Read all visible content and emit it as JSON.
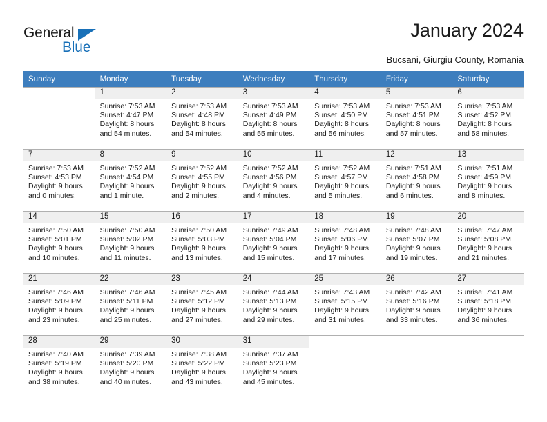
{
  "brand": {
    "name_part1": "General",
    "name_part2": "Blue",
    "accent_color": "#1870b8"
  },
  "header": {
    "title": "January 2024",
    "subtitle": "Bucsani, Giurgiu County, Romania",
    "header_bg_color": "#3d7ebe",
    "daynum_bg_color": "#efefef"
  },
  "weekday_headers": [
    "Sunday",
    "Monday",
    "Tuesday",
    "Wednesday",
    "Thursday",
    "Friday",
    "Saturday"
  ],
  "weeks": [
    [
      {
        "day": "",
        "sunrise": "",
        "sunset": "",
        "daylight1": "",
        "daylight2": "",
        "empty": true
      },
      {
        "day": "1",
        "sunrise": "Sunrise: 7:53 AM",
        "sunset": "Sunset: 4:47 PM",
        "daylight1": "Daylight: 8 hours",
        "daylight2": "and 54 minutes.",
        "empty": false
      },
      {
        "day": "2",
        "sunrise": "Sunrise: 7:53 AM",
        "sunset": "Sunset: 4:48 PM",
        "daylight1": "Daylight: 8 hours",
        "daylight2": "and 54 minutes.",
        "empty": false
      },
      {
        "day": "3",
        "sunrise": "Sunrise: 7:53 AM",
        "sunset": "Sunset: 4:49 PM",
        "daylight1": "Daylight: 8 hours",
        "daylight2": "and 55 minutes.",
        "empty": false
      },
      {
        "day": "4",
        "sunrise": "Sunrise: 7:53 AM",
        "sunset": "Sunset: 4:50 PM",
        "daylight1": "Daylight: 8 hours",
        "daylight2": "and 56 minutes.",
        "empty": false
      },
      {
        "day": "5",
        "sunrise": "Sunrise: 7:53 AM",
        "sunset": "Sunset: 4:51 PM",
        "daylight1": "Daylight: 8 hours",
        "daylight2": "and 57 minutes.",
        "empty": false
      },
      {
        "day": "6",
        "sunrise": "Sunrise: 7:53 AM",
        "sunset": "Sunset: 4:52 PM",
        "daylight1": "Daylight: 8 hours",
        "daylight2": "and 58 minutes.",
        "empty": false
      }
    ],
    [
      {
        "day": "7",
        "sunrise": "Sunrise: 7:53 AM",
        "sunset": "Sunset: 4:53 PM",
        "daylight1": "Daylight: 9 hours",
        "daylight2": "and 0 minutes.",
        "empty": false
      },
      {
        "day": "8",
        "sunrise": "Sunrise: 7:52 AM",
        "sunset": "Sunset: 4:54 PM",
        "daylight1": "Daylight: 9 hours",
        "daylight2": "and 1 minute.",
        "empty": false
      },
      {
        "day": "9",
        "sunrise": "Sunrise: 7:52 AM",
        "sunset": "Sunset: 4:55 PM",
        "daylight1": "Daylight: 9 hours",
        "daylight2": "and 2 minutes.",
        "empty": false
      },
      {
        "day": "10",
        "sunrise": "Sunrise: 7:52 AM",
        "sunset": "Sunset: 4:56 PM",
        "daylight1": "Daylight: 9 hours",
        "daylight2": "and 4 minutes.",
        "empty": false
      },
      {
        "day": "11",
        "sunrise": "Sunrise: 7:52 AM",
        "sunset": "Sunset: 4:57 PM",
        "daylight1": "Daylight: 9 hours",
        "daylight2": "and 5 minutes.",
        "empty": false
      },
      {
        "day": "12",
        "sunrise": "Sunrise: 7:51 AM",
        "sunset": "Sunset: 4:58 PM",
        "daylight1": "Daylight: 9 hours",
        "daylight2": "and 6 minutes.",
        "empty": false
      },
      {
        "day": "13",
        "sunrise": "Sunrise: 7:51 AM",
        "sunset": "Sunset: 4:59 PM",
        "daylight1": "Daylight: 9 hours",
        "daylight2": "and 8 minutes.",
        "empty": false
      }
    ],
    [
      {
        "day": "14",
        "sunrise": "Sunrise: 7:50 AM",
        "sunset": "Sunset: 5:01 PM",
        "daylight1": "Daylight: 9 hours",
        "daylight2": "and 10 minutes.",
        "empty": false
      },
      {
        "day": "15",
        "sunrise": "Sunrise: 7:50 AM",
        "sunset": "Sunset: 5:02 PM",
        "daylight1": "Daylight: 9 hours",
        "daylight2": "and 11 minutes.",
        "empty": false
      },
      {
        "day": "16",
        "sunrise": "Sunrise: 7:50 AM",
        "sunset": "Sunset: 5:03 PM",
        "daylight1": "Daylight: 9 hours",
        "daylight2": "and 13 minutes.",
        "empty": false
      },
      {
        "day": "17",
        "sunrise": "Sunrise: 7:49 AM",
        "sunset": "Sunset: 5:04 PM",
        "daylight1": "Daylight: 9 hours",
        "daylight2": "and 15 minutes.",
        "empty": false
      },
      {
        "day": "18",
        "sunrise": "Sunrise: 7:48 AM",
        "sunset": "Sunset: 5:06 PM",
        "daylight1": "Daylight: 9 hours",
        "daylight2": "and 17 minutes.",
        "empty": false
      },
      {
        "day": "19",
        "sunrise": "Sunrise: 7:48 AM",
        "sunset": "Sunset: 5:07 PM",
        "daylight1": "Daylight: 9 hours",
        "daylight2": "and 19 minutes.",
        "empty": false
      },
      {
        "day": "20",
        "sunrise": "Sunrise: 7:47 AM",
        "sunset": "Sunset: 5:08 PM",
        "daylight1": "Daylight: 9 hours",
        "daylight2": "and 21 minutes.",
        "empty": false
      }
    ],
    [
      {
        "day": "21",
        "sunrise": "Sunrise: 7:46 AM",
        "sunset": "Sunset: 5:09 PM",
        "daylight1": "Daylight: 9 hours",
        "daylight2": "and 23 minutes.",
        "empty": false
      },
      {
        "day": "22",
        "sunrise": "Sunrise: 7:46 AM",
        "sunset": "Sunset: 5:11 PM",
        "daylight1": "Daylight: 9 hours",
        "daylight2": "and 25 minutes.",
        "empty": false
      },
      {
        "day": "23",
        "sunrise": "Sunrise: 7:45 AM",
        "sunset": "Sunset: 5:12 PM",
        "daylight1": "Daylight: 9 hours",
        "daylight2": "and 27 minutes.",
        "empty": false
      },
      {
        "day": "24",
        "sunrise": "Sunrise: 7:44 AM",
        "sunset": "Sunset: 5:13 PM",
        "daylight1": "Daylight: 9 hours",
        "daylight2": "and 29 minutes.",
        "empty": false
      },
      {
        "day": "25",
        "sunrise": "Sunrise: 7:43 AM",
        "sunset": "Sunset: 5:15 PM",
        "daylight1": "Daylight: 9 hours",
        "daylight2": "and 31 minutes.",
        "empty": false
      },
      {
        "day": "26",
        "sunrise": "Sunrise: 7:42 AM",
        "sunset": "Sunset: 5:16 PM",
        "daylight1": "Daylight: 9 hours",
        "daylight2": "and 33 minutes.",
        "empty": false
      },
      {
        "day": "27",
        "sunrise": "Sunrise: 7:41 AM",
        "sunset": "Sunset: 5:18 PM",
        "daylight1": "Daylight: 9 hours",
        "daylight2": "and 36 minutes.",
        "empty": false
      }
    ],
    [
      {
        "day": "28",
        "sunrise": "Sunrise: 7:40 AM",
        "sunset": "Sunset: 5:19 PM",
        "daylight1": "Daylight: 9 hours",
        "daylight2": "and 38 minutes.",
        "empty": false
      },
      {
        "day": "29",
        "sunrise": "Sunrise: 7:39 AM",
        "sunset": "Sunset: 5:20 PM",
        "daylight1": "Daylight: 9 hours",
        "daylight2": "and 40 minutes.",
        "empty": false
      },
      {
        "day": "30",
        "sunrise": "Sunrise: 7:38 AM",
        "sunset": "Sunset: 5:22 PM",
        "daylight1": "Daylight: 9 hours",
        "daylight2": "and 43 minutes.",
        "empty": false
      },
      {
        "day": "31",
        "sunrise": "Sunrise: 7:37 AM",
        "sunset": "Sunset: 5:23 PM",
        "daylight1": "Daylight: 9 hours",
        "daylight2": "and 45 minutes.",
        "empty": false
      },
      {
        "day": "",
        "sunrise": "",
        "sunset": "",
        "daylight1": "",
        "daylight2": "",
        "empty": true
      },
      {
        "day": "",
        "sunrise": "",
        "sunset": "",
        "daylight1": "",
        "daylight2": "",
        "empty": true
      },
      {
        "day": "",
        "sunrise": "",
        "sunset": "",
        "daylight1": "",
        "daylight2": "",
        "empty": true
      }
    ]
  ]
}
